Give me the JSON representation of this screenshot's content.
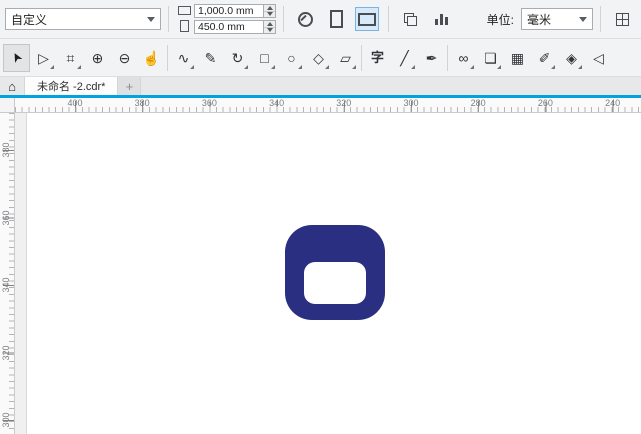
{
  "property_bar": {
    "preset": {
      "value": "自定义"
    },
    "page_size": {
      "width": "1,000.0 mm",
      "height": "450.0 mm"
    },
    "units": {
      "label": "单位:",
      "value": "毫米"
    }
  },
  "toolbox": {
    "tools": [
      {
        "id": "pick-tool",
        "glyph": "➤",
        "active": true
      },
      {
        "id": "shape-tool",
        "glyph": "▷",
        "dd": true
      },
      {
        "id": "crop-tool",
        "glyph": "⌗",
        "dd": true
      },
      {
        "id": "zoom-in-tool",
        "glyph": "⊕"
      },
      {
        "id": "zoom-out-tool",
        "glyph": "⊖"
      },
      {
        "id": "pan-tool",
        "glyph": "☝",
        "sep": true
      },
      {
        "id": "freehand-tool",
        "glyph": "∿",
        "dd": true
      },
      {
        "id": "artistic-media-tool",
        "glyph": "✎"
      },
      {
        "id": "bspline-tool",
        "glyph": "↻",
        "dd": true
      },
      {
        "id": "rectangle-tool",
        "glyph": "□",
        "dd": true
      },
      {
        "id": "ellipse-tool",
        "glyph": "○",
        "dd": true
      },
      {
        "id": "polygon-tool",
        "glyph": "◇",
        "dd": true
      },
      {
        "id": "common-shapes-tool",
        "glyph": "▱",
        "dd": true,
        "sep": true
      },
      {
        "id": "text-tool",
        "glyph": "字"
      },
      {
        "id": "line-tool",
        "glyph": "╱",
        "dd": true
      },
      {
        "id": "pen-tool",
        "glyph": "✒",
        "sep": true
      },
      {
        "id": "connector-tool",
        "glyph": "∞",
        "dd": true
      },
      {
        "id": "drop-shadow-tool",
        "glyph": "❏",
        "dd": true
      },
      {
        "id": "transparency-tool",
        "glyph": "▦"
      },
      {
        "id": "eyedropper-tool",
        "glyph": "✐",
        "dd": true
      },
      {
        "id": "fill-tool",
        "glyph": "◈",
        "dd": true
      },
      {
        "id": "outline-tool",
        "glyph": "◁"
      }
    ]
  },
  "tabbar": {
    "home_glyph": "⌂",
    "document_tab": "未命名 -2.cdr*",
    "new_tab": "+"
  },
  "rulers": {
    "horizontal_labels": [
      "400",
      "380",
      "360",
      "340",
      "320",
      "300",
      "280",
      "260",
      "240"
    ],
    "vertical_labels": [
      "380",
      "360",
      "340",
      "320",
      "300"
    ]
  },
  "canvas": {
    "shape_fill": "#2b2f82"
  },
  "colors": {
    "accent": "#00a3e0"
  }
}
